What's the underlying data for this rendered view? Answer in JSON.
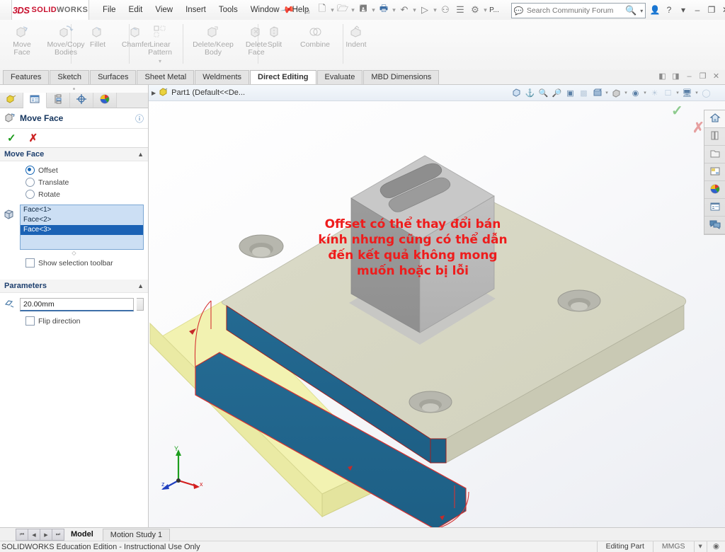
{
  "app": {
    "brand_3ds": "3DS",
    "brand_name_bold": "SOLID",
    "brand_name_light": "WORKS",
    "accent_red": "#c8102e"
  },
  "menu": {
    "items": [
      {
        "label": "File"
      },
      {
        "label": "Edit"
      },
      {
        "label": "View"
      },
      {
        "label": "Insert"
      },
      {
        "label": "Tools"
      },
      {
        "label": "Window"
      },
      {
        "label": "Help"
      }
    ],
    "pin_icon": "pushpin-icon"
  },
  "quick_access": {
    "icons": [
      "home-icon",
      "new-document-icon",
      "open-folder-icon",
      "save-icon",
      "print-icon",
      "undo-icon",
      "select-icon",
      "attach-icon",
      "rebuild-icon",
      "options-gear-icon"
    ],
    "overflow_label": "P..."
  },
  "search": {
    "placeholder": "Search Community Forum",
    "value": "",
    "chat_icon": "community-chat-icon",
    "magnifier_icon": "search-icon",
    "caret_icon": "chevron-down-icon"
  },
  "window_controls": {
    "profile_icon": "user-account-icon",
    "help_icon": "help-question-icon",
    "caret_icon": "chevron-down-icon",
    "minimize": "–",
    "maximize": "❐",
    "close": "✕"
  },
  "document_window_controls": {
    "restore_left": "◧",
    "restore_right": "◨",
    "minimize": "–",
    "restore": "❐",
    "close": "✕"
  },
  "ribbon": {
    "groups": [
      {
        "buttons": [
          {
            "label_line1": "Move",
            "label_line2": "Face",
            "icon": "move-face-icon"
          },
          {
            "label_line1": "Move/Copy",
            "label_line2": "Bodies",
            "icon": "move-copy-bodies-icon"
          }
        ]
      },
      {
        "buttons": [
          {
            "label_line1": "Fillet",
            "label_line2": "",
            "icon": "fillet-icon"
          },
          {
            "label_line1": "Chamfer",
            "label_line2": "",
            "icon": "chamfer-icon"
          }
        ]
      },
      {
        "buttons": [
          {
            "label_line1": "Linear Pattern",
            "label_line2": "",
            "icon": "linear-pattern-icon",
            "has_caret": true
          }
        ]
      },
      {
        "buttons": [
          {
            "label_line1": "Delete/Keep",
            "label_line2": "Body",
            "icon": "delete-keep-body-icon"
          },
          {
            "label_line1": "Delete",
            "label_line2": "Face",
            "icon": "delete-face-icon"
          }
        ]
      },
      {
        "buttons": [
          {
            "label_line1": "Split",
            "label_line2": "",
            "icon": "split-icon"
          },
          {
            "label_line1": "Combine",
            "label_line2": "",
            "icon": "combine-icon"
          },
          {
            "label_line1": "Indent",
            "label_line2": "",
            "icon": "indent-icon"
          }
        ]
      }
    ]
  },
  "command_tabs": {
    "items": [
      {
        "label": "Features",
        "active": false
      },
      {
        "label": "Sketch",
        "active": false
      },
      {
        "label": "Surfaces",
        "active": false
      },
      {
        "label": "Sheet Metal",
        "active": false
      },
      {
        "label": "Weldments",
        "active": false
      },
      {
        "label": "Direct Editing",
        "active": true
      },
      {
        "label": "Evaluate",
        "active": false
      },
      {
        "label": "MBD Dimensions",
        "active": false
      }
    ]
  },
  "property_manager": {
    "tabs": [
      {
        "name": "feature-manager-tree",
        "icon": "feature-tree-icon",
        "active": false
      },
      {
        "name": "property-manager",
        "icon": "property-manager-icon",
        "active": true
      },
      {
        "name": "configuration-manager",
        "icon": "configuration-manager-icon",
        "active": false
      },
      {
        "name": "dimxpert-manager",
        "icon": "dimxpert-icon",
        "active": false
      },
      {
        "name": "display-manager",
        "icon": "display-manager-icon",
        "active": false
      }
    ],
    "title": "Move Face",
    "title_icon": "move-face-icon",
    "help_icon": "help-question-icon",
    "ok_icon": "check-icon",
    "cancel_icon": "cross-icon",
    "move_face_section": {
      "title": "Move Face",
      "collapse_icon": "chevron-up-icon",
      "options": [
        {
          "label": "Offset",
          "selected": true
        },
        {
          "label": "Translate",
          "selected": false
        },
        {
          "label": "Rotate",
          "selected": false
        }
      ],
      "selection_icon": "face-selection-icon",
      "faces": [
        {
          "label": "Face<1>",
          "selected": false
        },
        {
          "label": "Face<2>",
          "selected": false
        },
        {
          "label": "Face<3>",
          "selected": true
        }
      ],
      "show_selection_toolbar": {
        "label": "Show selection toolbar",
        "checked": false
      }
    },
    "parameters_section": {
      "title": "Parameters",
      "collapse_icon": "chevron-up-icon",
      "distance_icon": "offset-distance-icon",
      "distance_value": "20.00mm",
      "flip_direction": {
        "label": "Flip direction",
        "checked": false
      }
    }
  },
  "feature_tree_header": {
    "expand_icon": "chevron-right-icon",
    "part_icon": "part-document-icon",
    "label": "Part1  (Default<<De..."
  },
  "view_toolbar": {
    "icons": [
      "zoom-to-fit-icon",
      "zoom-to-area-icon",
      "previous-view-icon",
      "section-view-icon",
      "view-orientation-icon",
      "display-style-icon",
      "hide-show-icon",
      "edit-appearance-icon",
      "scene-icon",
      "view-settings-icon",
      "apply-scene-icon"
    ]
  },
  "annotation": {
    "text": "Offset có thể thay đổi bán kính nhưng cũng có thể dẫn đến kết quả không mong muốn hoặc bị lỗi",
    "color": "#ee1c1c"
  },
  "confirmation_corner": {
    "ok_icon": "check-icon",
    "cancel_icon": "cross-icon"
  },
  "triad": {
    "x_label": "x",
    "y_label": "Y",
    "z_label": "z",
    "x_color": "#d32020",
    "y_color": "#1e9e1e",
    "z_color": "#2040c0"
  },
  "model": {
    "plate_top_color": "#d7d7c3",
    "plate_side_color": "#c3c3ab",
    "selected_face_color": "#1f6a92",
    "preview_body_color": "#f0f0a8",
    "preview_outline_color": "#d03030",
    "boss_color": "#b9b9b9"
  },
  "task_pane": {
    "buttons": [
      {
        "name": "solidworks-resources",
        "icon": "home-icon",
        "active": true
      },
      {
        "name": "design-library",
        "icon": "design-library-icon",
        "active": false
      },
      {
        "name": "file-explorer",
        "icon": "folder-icon",
        "active": false
      },
      {
        "name": "view-palette",
        "icon": "view-palette-icon",
        "active": false
      },
      {
        "name": "appearances-scenes",
        "icon": "appearances-icon",
        "active": false
      },
      {
        "name": "custom-properties",
        "icon": "custom-properties-icon",
        "active": false
      },
      {
        "name": "solidworks-forum",
        "icon": "forum-chat-icon",
        "active": false
      }
    ]
  },
  "bottom": {
    "nav_buttons": [
      "⏮",
      "◀",
      "▶",
      "⏭"
    ],
    "tabs": [
      {
        "label": "Model",
        "active": true
      },
      {
        "label": "Motion Study 1",
        "active": false
      }
    ]
  },
  "status_bar": {
    "message": "SOLIDWORKS Education Edition - Instructional Use Only",
    "editing_state": "Editing Part",
    "units": "MMGS",
    "units_caret": "▾",
    "units_icon": "units-settings-icon"
  }
}
